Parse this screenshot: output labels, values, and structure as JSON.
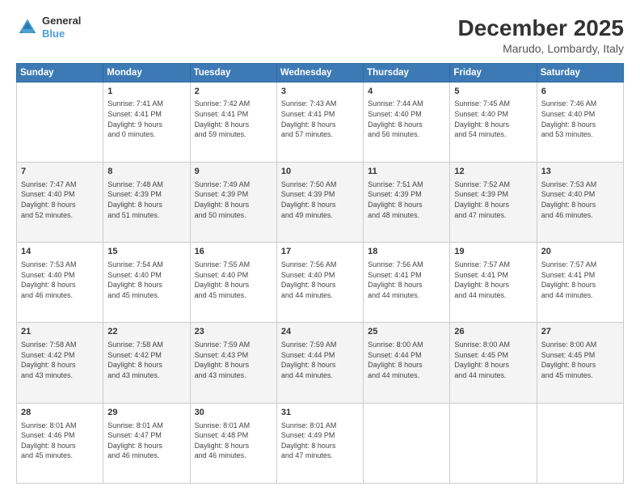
{
  "header": {
    "logo_line1": "General",
    "logo_line2": "Blue",
    "title": "December 2025",
    "subtitle": "Marudo, Lombardy, Italy"
  },
  "columns": [
    "Sunday",
    "Monday",
    "Tuesday",
    "Wednesday",
    "Thursday",
    "Friday",
    "Saturday"
  ],
  "weeks": [
    [
      {
        "day": "",
        "info": ""
      },
      {
        "day": "1",
        "info": "Sunrise: 7:41 AM\nSunset: 4:41 PM\nDaylight: 9 hours\nand 0 minutes."
      },
      {
        "day": "2",
        "info": "Sunrise: 7:42 AM\nSunset: 4:41 PM\nDaylight: 8 hours\nand 59 minutes."
      },
      {
        "day": "3",
        "info": "Sunrise: 7:43 AM\nSunset: 4:41 PM\nDaylight: 8 hours\nand 57 minutes."
      },
      {
        "day": "4",
        "info": "Sunrise: 7:44 AM\nSunset: 4:40 PM\nDaylight: 8 hours\nand 56 minutes."
      },
      {
        "day": "5",
        "info": "Sunrise: 7:45 AM\nSunset: 4:40 PM\nDaylight: 8 hours\nand 54 minutes."
      },
      {
        "day": "6",
        "info": "Sunrise: 7:46 AM\nSunset: 4:40 PM\nDaylight: 8 hours\nand 53 minutes."
      }
    ],
    [
      {
        "day": "7",
        "info": "Sunrise: 7:47 AM\nSunset: 4:40 PM\nDaylight: 8 hours\nand 52 minutes."
      },
      {
        "day": "8",
        "info": "Sunrise: 7:48 AM\nSunset: 4:39 PM\nDaylight: 8 hours\nand 51 minutes."
      },
      {
        "day": "9",
        "info": "Sunrise: 7:49 AM\nSunset: 4:39 PM\nDaylight: 8 hours\nand 50 minutes."
      },
      {
        "day": "10",
        "info": "Sunrise: 7:50 AM\nSunset: 4:39 PM\nDaylight: 8 hours\nand 49 minutes."
      },
      {
        "day": "11",
        "info": "Sunrise: 7:51 AM\nSunset: 4:39 PM\nDaylight: 8 hours\nand 48 minutes."
      },
      {
        "day": "12",
        "info": "Sunrise: 7:52 AM\nSunset: 4:39 PM\nDaylight: 8 hours\nand 47 minutes."
      },
      {
        "day": "13",
        "info": "Sunrise: 7:53 AM\nSunset: 4:40 PM\nDaylight: 8 hours\nand 46 minutes."
      }
    ],
    [
      {
        "day": "14",
        "info": "Sunrise: 7:53 AM\nSunset: 4:40 PM\nDaylight: 8 hours\nand 46 minutes."
      },
      {
        "day": "15",
        "info": "Sunrise: 7:54 AM\nSunset: 4:40 PM\nDaylight: 8 hours\nand 45 minutes."
      },
      {
        "day": "16",
        "info": "Sunrise: 7:55 AM\nSunset: 4:40 PM\nDaylight: 8 hours\nand 45 minutes."
      },
      {
        "day": "17",
        "info": "Sunrise: 7:56 AM\nSunset: 4:40 PM\nDaylight: 8 hours\nand 44 minutes."
      },
      {
        "day": "18",
        "info": "Sunrise: 7:56 AM\nSunset: 4:41 PM\nDaylight: 8 hours\nand 44 minutes."
      },
      {
        "day": "19",
        "info": "Sunrise: 7:57 AM\nSunset: 4:41 PM\nDaylight: 8 hours\nand 44 minutes."
      },
      {
        "day": "20",
        "info": "Sunrise: 7:57 AM\nSunset: 4:41 PM\nDaylight: 8 hours\nand 44 minutes."
      }
    ],
    [
      {
        "day": "21",
        "info": "Sunrise: 7:58 AM\nSunset: 4:42 PM\nDaylight: 8 hours\nand 43 minutes."
      },
      {
        "day": "22",
        "info": "Sunrise: 7:58 AM\nSunset: 4:42 PM\nDaylight: 8 hours\nand 43 minutes."
      },
      {
        "day": "23",
        "info": "Sunrise: 7:59 AM\nSunset: 4:43 PM\nDaylight: 8 hours\nand 43 minutes."
      },
      {
        "day": "24",
        "info": "Sunrise: 7:59 AM\nSunset: 4:44 PM\nDaylight: 8 hours\nand 44 minutes."
      },
      {
        "day": "25",
        "info": "Sunrise: 8:00 AM\nSunset: 4:44 PM\nDaylight: 8 hours\nand 44 minutes."
      },
      {
        "day": "26",
        "info": "Sunrise: 8:00 AM\nSunset: 4:45 PM\nDaylight: 8 hours\nand 44 minutes."
      },
      {
        "day": "27",
        "info": "Sunrise: 8:00 AM\nSunset: 4:45 PM\nDaylight: 8 hours\nand 45 minutes."
      }
    ],
    [
      {
        "day": "28",
        "info": "Sunrise: 8:01 AM\nSunset: 4:46 PM\nDaylight: 8 hours\nand 45 minutes."
      },
      {
        "day": "29",
        "info": "Sunrise: 8:01 AM\nSunset: 4:47 PM\nDaylight: 8 hours\nand 46 minutes."
      },
      {
        "day": "30",
        "info": "Sunrise: 8:01 AM\nSunset: 4:48 PM\nDaylight: 8 hours\nand 46 minutes."
      },
      {
        "day": "31",
        "info": "Sunrise: 8:01 AM\nSunset: 4:49 PM\nDaylight: 8 hours\nand 47 minutes."
      },
      {
        "day": "",
        "info": ""
      },
      {
        "day": "",
        "info": ""
      },
      {
        "day": "",
        "info": ""
      }
    ]
  ]
}
